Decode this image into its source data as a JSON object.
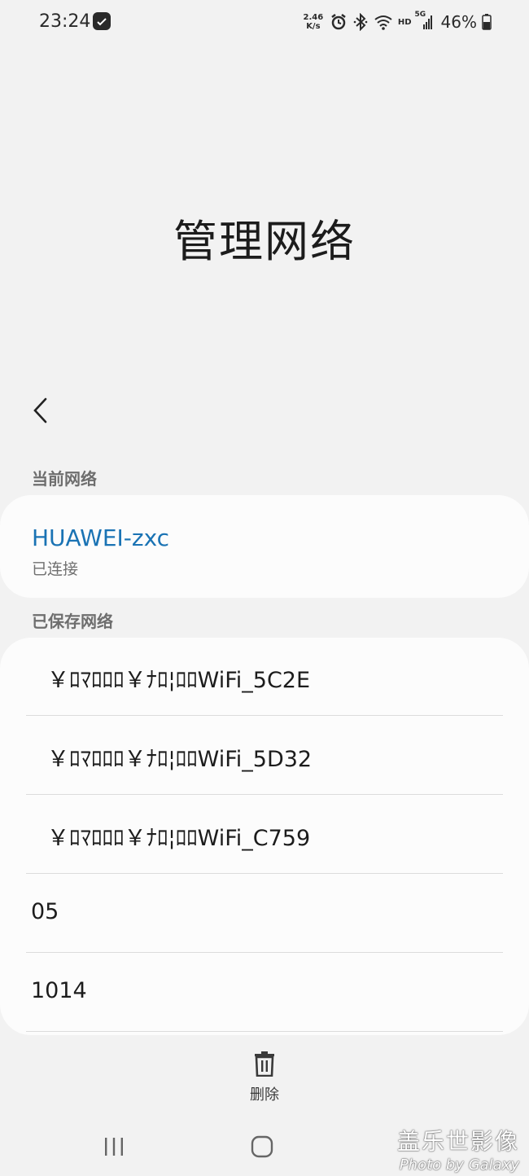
{
  "status_bar": {
    "time": "23:24",
    "net_speed_value": "2.46",
    "net_speed_unit": "K/s",
    "hd_label": "HD",
    "net_type": "5G",
    "battery": "46%",
    "icons": [
      "notification-icon",
      "alarm-icon",
      "bluetooth-icon",
      "wifi-icon",
      "cellular-signal-icon",
      "battery-icon"
    ]
  },
  "page": {
    "title": "管理网络"
  },
  "current_network": {
    "section_label": "当前网络",
    "name": "HUAWEI-zxc",
    "status": "已连接",
    "name_color": "#1a73b4"
  },
  "saved_networks": {
    "section_label": "已保存网络",
    "items": [
      {
        "label": "￥ﾛﾏﾛﾛﾛ￥ﾅﾛ¦ﾛﾛWiFi_5C2E"
      },
      {
        "label": "￥ﾛﾏﾛﾛﾛ￥ﾅﾛ¦ﾛﾛWiFi_5D32"
      },
      {
        "label": "￥ﾛﾏﾛﾛﾛ￥ﾅﾛ¦ﾛﾛWiFi_C759"
      },
      {
        "label": "05"
      },
      {
        "label": "1014"
      }
    ]
  },
  "actions": {
    "delete_label": "删除"
  },
  "watermark": {
    "line1": "盖乐世影像",
    "line2": "Photo by Galaxy"
  }
}
